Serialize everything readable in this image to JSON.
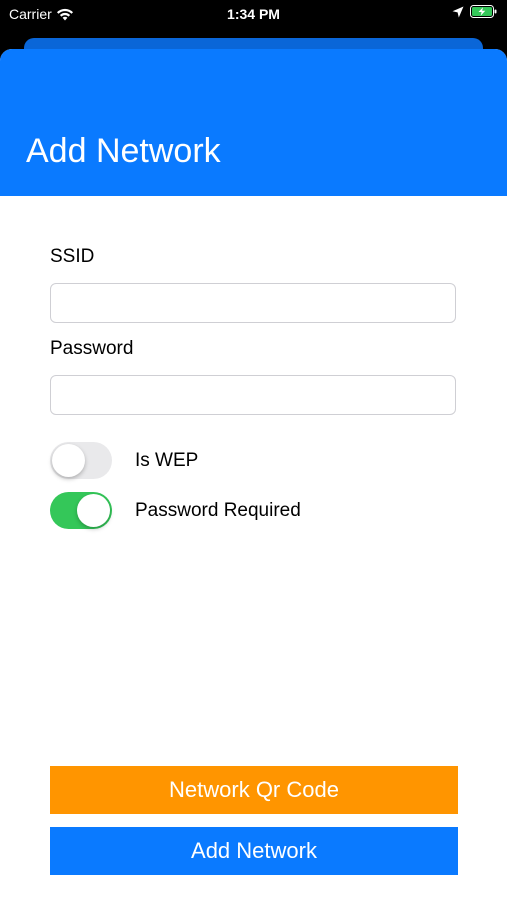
{
  "status_bar": {
    "carrier": "Carrier",
    "time": "1:34 PM",
    "icons": [
      "wifi-icon",
      "location-icon",
      "battery-charging-icon"
    ]
  },
  "header": {
    "title": "Add Network"
  },
  "form": {
    "ssid_label": "SSID",
    "ssid_value": "",
    "password_label": "Password",
    "password_value": "",
    "is_wep_label": "Is WEP",
    "is_wep_on": false,
    "password_required_label": "Password Required",
    "password_required_on": true
  },
  "buttons": {
    "qr_code_label": "Network Qr Code",
    "add_network_label": "Add Network"
  },
  "colors": {
    "header_blue": "#0a7aff",
    "qr_button_orange": "#ff9500",
    "add_button_blue": "#0a7aff",
    "toggle_on_green": "#34c759",
    "toggle_off_gray": "#e9e9eb"
  }
}
